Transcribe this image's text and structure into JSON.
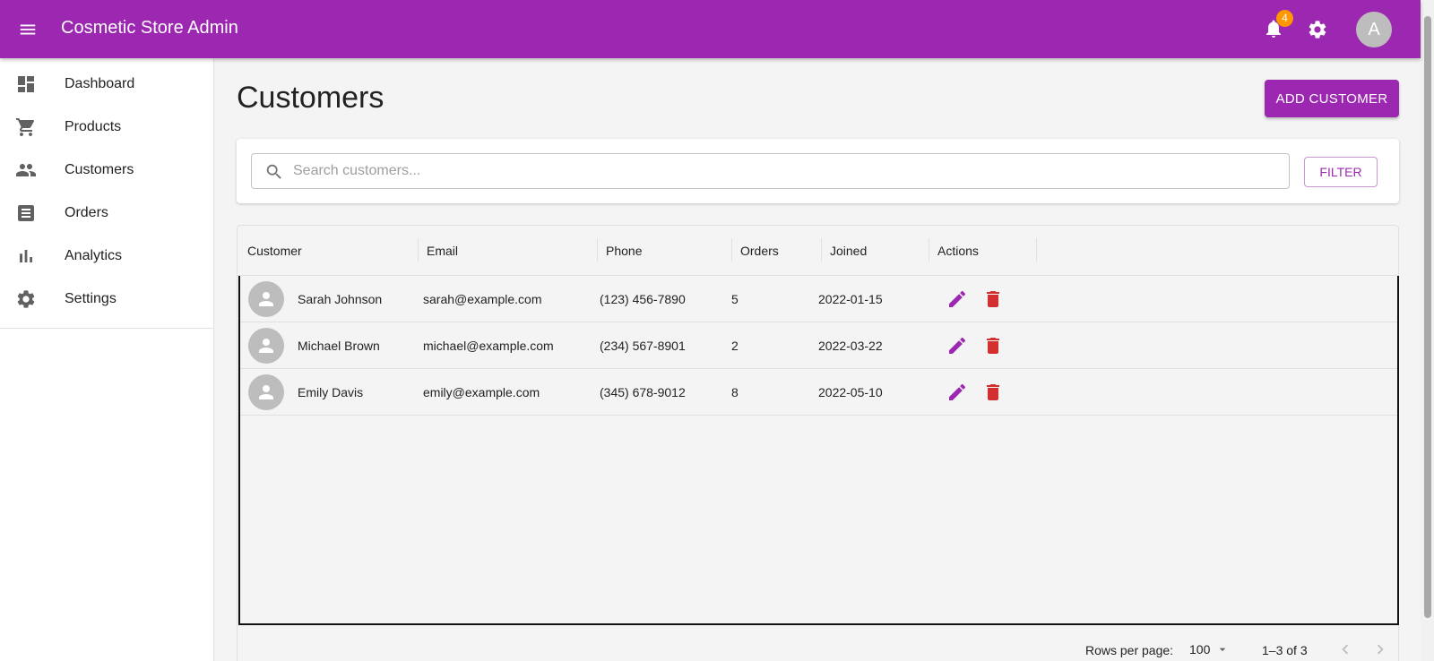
{
  "appbar": {
    "title": "Cosmetic Store Admin",
    "notification_count": "4",
    "avatar_letter": "A",
    "color": "#9c27b0",
    "badge_color": "#ff9800"
  },
  "sidebar": {
    "items": [
      {
        "label": "Dashboard",
        "icon": "dashboard-icon"
      },
      {
        "label": "Products",
        "icon": "cart-icon"
      },
      {
        "label": "Customers",
        "icon": "people-icon"
      },
      {
        "label": "Orders",
        "icon": "receipt-icon"
      },
      {
        "label": "Analytics",
        "icon": "bar-chart-icon"
      },
      {
        "label": "Settings",
        "icon": "gear-icon"
      }
    ]
  },
  "main": {
    "title": "Customers",
    "add_button": "ADD CUSTOMER",
    "search_placeholder": "Search customers...",
    "search_value": "",
    "filter_button": "FILTER"
  },
  "table": {
    "columns": [
      "Customer",
      "Email",
      "Phone",
      "Orders",
      "Joined",
      "Actions"
    ],
    "rows": [
      {
        "name": "Sarah Johnson",
        "email": "sarah@example.com",
        "phone": "(123) 456-7890",
        "orders": "5",
        "joined": "2022-01-15"
      },
      {
        "name": "Michael Brown",
        "email": "michael@example.com",
        "phone": "(234) 567-8901",
        "orders": "2",
        "joined": "2022-03-22"
      },
      {
        "name": "Emily Davis",
        "email": "emily@example.com",
        "phone": "(345) 678-9012",
        "orders": "8",
        "joined": "2022-05-10"
      }
    ],
    "edit_color": "#9c27b0",
    "delete_color": "#d32f2f"
  },
  "pagination": {
    "rows_per_page_label": "Rows per page:",
    "rows_per_page": "100",
    "range": "1–3 of 3"
  }
}
